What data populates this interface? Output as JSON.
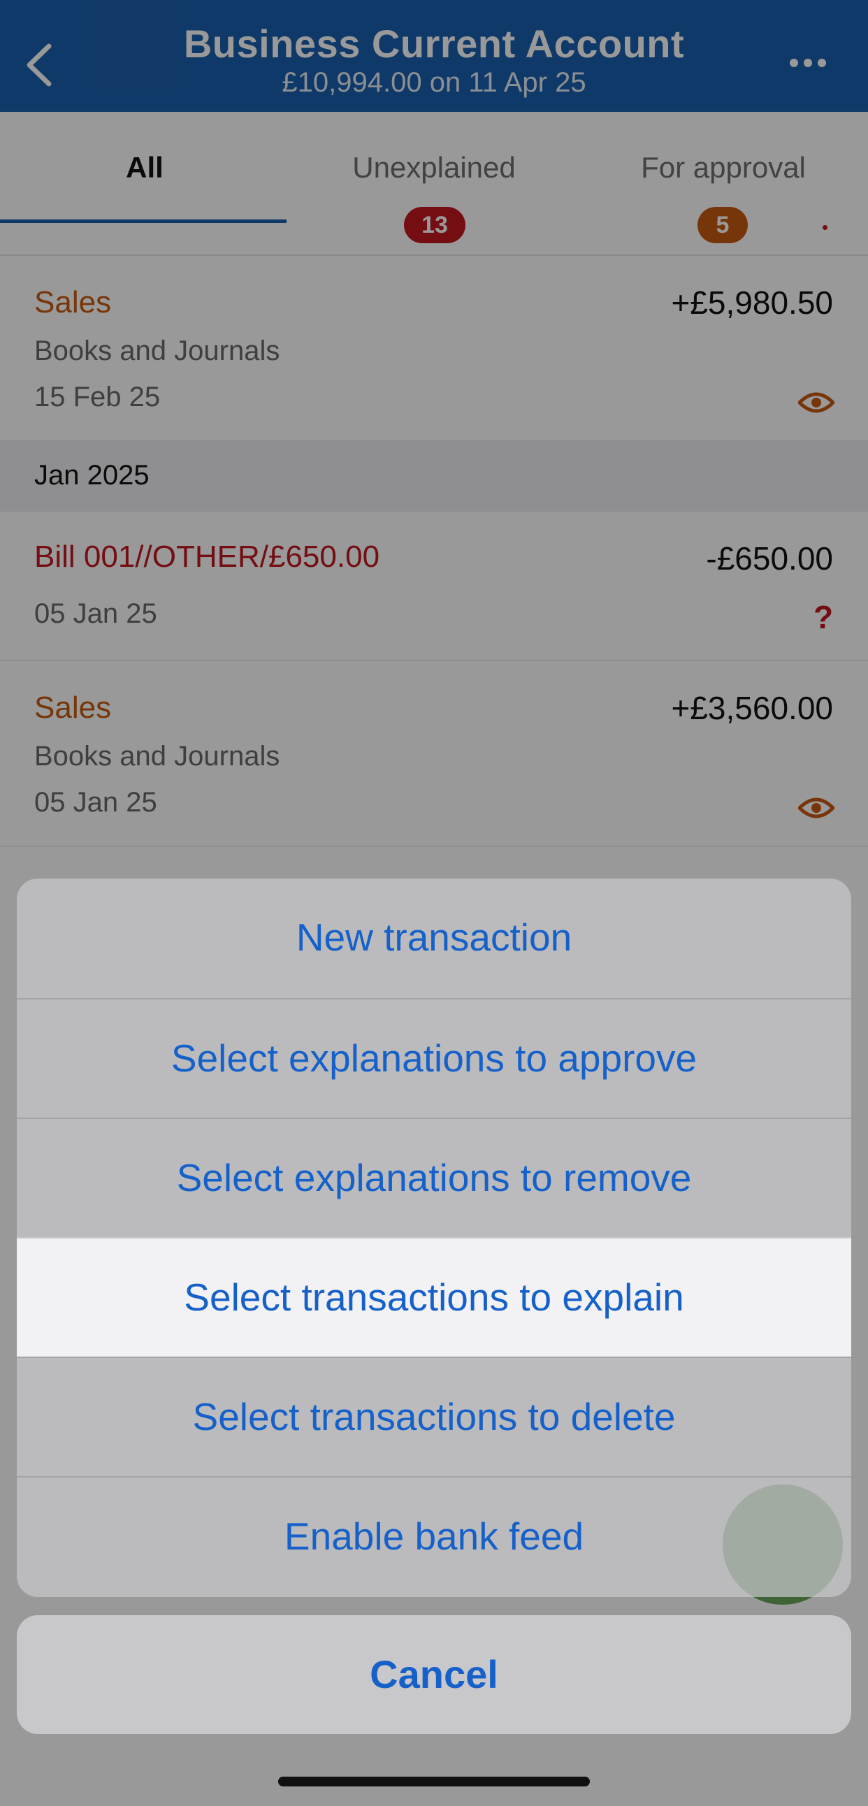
{
  "header": {
    "title": "Business Current Account",
    "subtitle": "£10,994.00 on 11 Apr 25",
    "back_icon": "chevron-left-icon",
    "more_icon": "ellipsis-icon"
  },
  "tabs": [
    {
      "label": "All",
      "badge": null,
      "selected": true
    },
    {
      "label": "Unexplained",
      "badge": "13"
    },
    {
      "label": "For approval",
      "badge": "5"
    }
  ],
  "transactions": [
    {
      "title": "Sales",
      "subtitle": "Books and Journals",
      "date": "15 Feb 25",
      "amount": "+£5,980.50",
      "status_icon": "eye-icon"
    },
    {
      "section": "Jan 2025"
    },
    {
      "title": "Bill 001//OTHER/£650.00",
      "date": "05 Jan 25",
      "amount": "-£650.00",
      "status_icon": "question-icon",
      "status_text": "?"
    },
    {
      "title": "Sales",
      "subtitle": "Books and Journals",
      "date": "05 Jan 25",
      "amount": "+£3,560.00",
      "status_icon": "eye-icon"
    }
  ],
  "action_sheet": {
    "items": [
      "New transaction",
      "Select explanations to approve",
      "Select explanations to remove",
      "Select transactions to explain",
      "Select transactions to delete",
      "Enable bank feed"
    ],
    "highlighted_index": 3,
    "cancel_label": "Cancel"
  },
  "colors": {
    "header_bg": "#1a5fad",
    "accent_blue": "#1561c9",
    "sales_orange": "#c75a12",
    "bill_red": "#c2181f"
  }
}
